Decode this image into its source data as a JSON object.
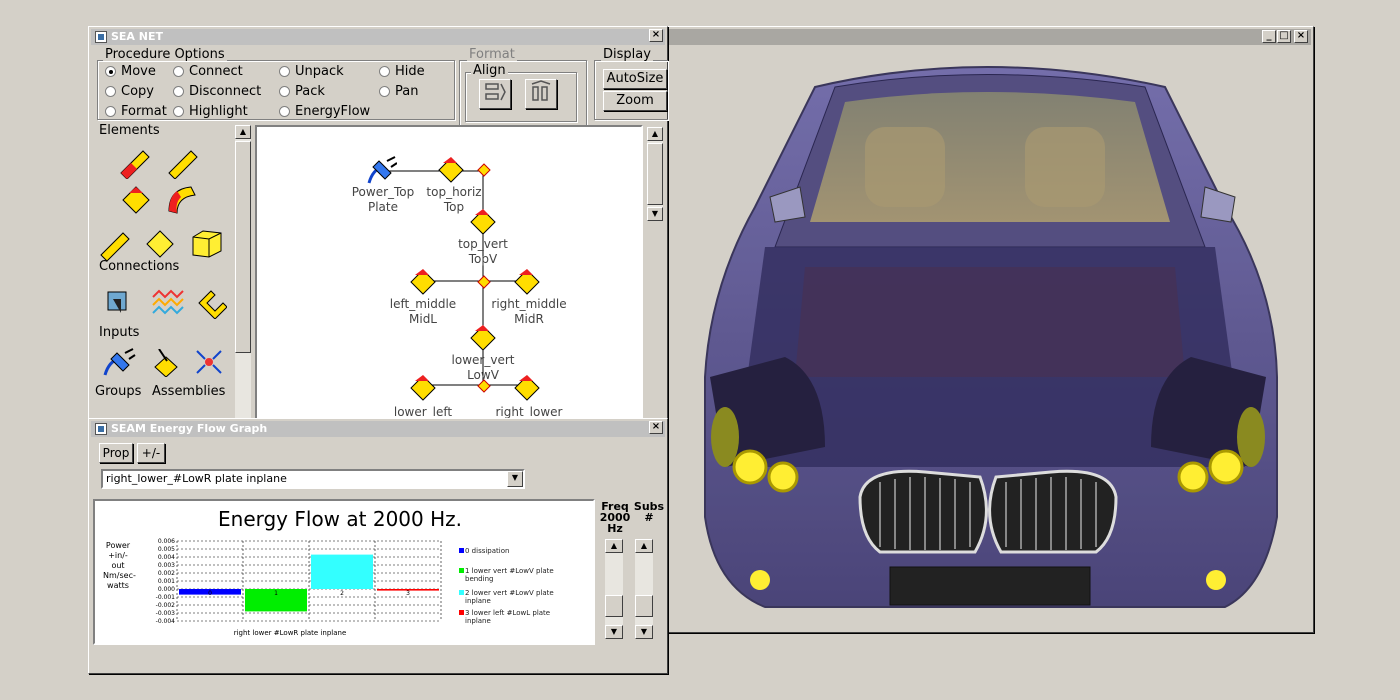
{
  "seanet": {
    "title": "SEA NET",
    "procedure": {
      "label": "Procedure Options",
      "options": [
        "Move",
        "Connect",
        "Unpack",
        "Hide",
        "Copy",
        "Disconnect",
        "Pack",
        "Pan",
        "Format",
        "Highlight",
        "EnergyFlow"
      ],
      "selected": "Move"
    },
    "format": {
      "label": "Format",
      "align_label": "Align"
    },
    "display": {
      "label": "Display",
      "autosize": "AutoSize",
      "zoom": "Zoom"
    },
    "palette": {
      "elements": "Elements",
      "connections": "Connections",
      "inputs": "Inputs",
      "groups": "Groups",
      "assemblies": "Assemblies"
    },
    "network": {
      "nodes": [
        {
          "name": "Power_Top",
          "sub": "Plate"
        },
        {
          "name": "top_horiz",
          "sub": "Top"
        },
        {
          "name": "top_vert",
          "sub": "TopV"
        },
        {
          "name": "left_middle",
          "sub": "MidL"
        },
        {
          "name": "right_middle",
          "sub": "MidR"
        },
        {
          "name": "lower_vert",
          "sub": "LowV"
        },
        {
          "name": "lower_left",
          "sub": ""
        },
        {
          "name": "right_lower",
          "sub": ""
        }
      ]
    }
  },
  "energy": {
    "title": "SEAM Energy Flow Graph",
    "prop_btn": "Prop",
    "plusminus_btn": "+/-",
    "selection": "right_lower_#LowR plate inplane",
    "freq_label": "Freq",
    "freq_value": "2000",
    "freq_unit": "Hz",
    "subs_label": "Subs",
    "subs_unit": "#"
  },
  "chart_data": {
    "type": "bar",
    "title": "Energy Flow at 2000 Hz.",
    "ylabel": "Power +in/-out Nm/sec-watts",
    "xlabel": "right lower #LowR plate inplane",
    "ylim": [
      -0.004,
      0.006
    ],
    "yticks": [
      "0.006",
      "0.005",
      "0.004",
      "0.003",
      "0.002",
      "0.001",
      "0.000",
      "-0.001",
      "-0.002",
      "-0.003",
      "-0.004"
    ],
    "categories": [
      "0",
      "1",
      "2",
      "3"
    ],
    "values": [
      -0.0007,
      -0.0028,
      0.0043,
      -0.0002
    ],
    "colors": [
      "#0000ff",
      "#00ee00",
      "#33ffff",
      "#ff0000"
    ],
    "legend": [
      "0 dissipation",
      "1 lower vert #LowV plate bending",
      "2 lower vert #LowV plate inplane",
      "3 lower left #LowL plate inplane"
    ],
    "legend_position": "right",
    "grid": true
  },
  "viewer": {
    "min": "_",
    "max": "□",
    "close": "×"
  },
  "icons": {
    "close": "×",
    "up": "▲",
    "down": "▼",
    "dropdown": "▼"
  }
}
